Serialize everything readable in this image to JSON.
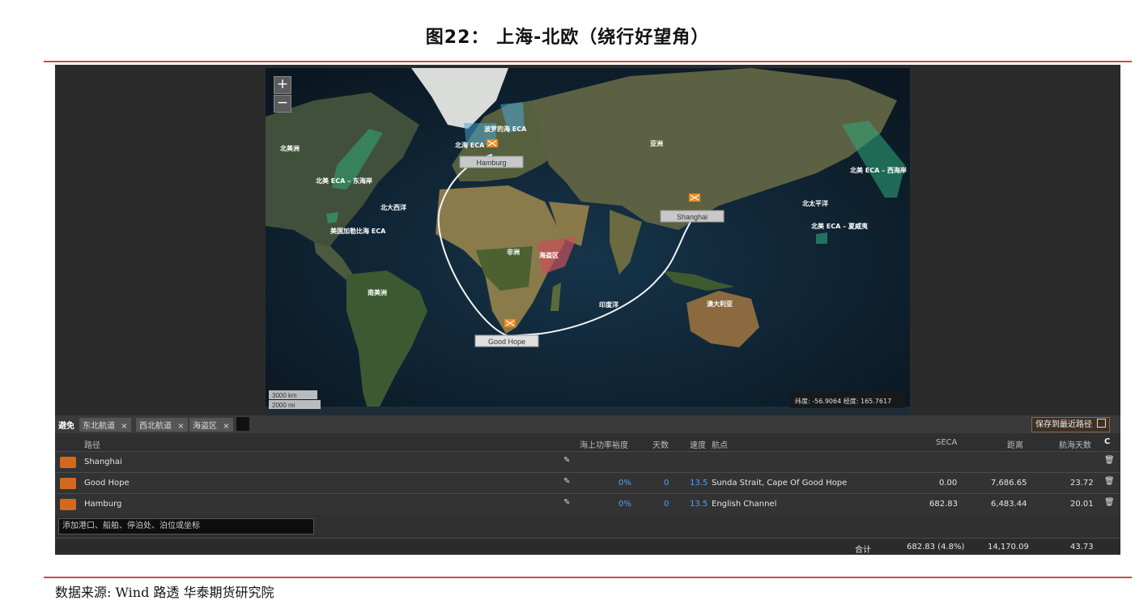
{
  "figure_title": "图22：  上海-北欧（绕行好望角）",
  "map": {
    "zoom_in": "+",
    "zoom_out": "−",
    "region_labels": {
      "north_america": "北美洲",
      "na_eca_east": "北美 ECA – 东海岸",
      "north_atlantic": "北大西洋",
      "us_caribbean_eca": "美国加勒比海 ECA",
      "south_america": "南美洲",
      "baltic_eca": "波罗的海 ECA",
      "north_sea_eca": "北海 ECA",
      "asia": "亚洲",
      "africa": "非洲",
      "piracy_zone": "海盗区",
      "indian_ocean": "印度洋",
      "north_pacific": "北太平洋",
      "na_eca_west": "北美 ECA – 西海岸",
      "na_eca_hawaii": "北美 ECA – 夏威夷",
      "australia": "澳大利亚"
    },
    "ports": {
      "hamburg": "Hamburg",
      "shanghai": "Shanghai",
      "good_hope": "Good Hope"
    },
    "scale_km": "3000 km",
    "scale_mi": "2000 mi",
    "coord_readout": "纬度: -56.9064 经度: 165.7617"
  },
  "toolbar": {
    "avoid_label": "避免",
    "tags": [
      "东北航道",
      "西北航道",
      "海盗区"
    ],
    "tag_close": "×",
    "save_button": "保存到最近路径",
    "save_icon": "save-icon"
  },
  "table": {
    "headers": {
      "route": "路径",
      "margin": "海上功率裕度",
      "days": "天数",
      "speed": "速度",
      "waypoints": "航点",
      "seca": "SECA",
      "distance": "距离",
      "sea_days": "航海天数",
      "refresh": "C"
    },
    "rows": [
      {
        "name": "Shanghai",
        "margin": "",
        "days": "",
        "speed": "",
        "waypoints": "",
        "seca": "",
        "distance": "",
        "sea_days": ""
      },
      {
        "name": "Good Hope",
        "margin": "0%",
        "days": "0",
        "speed": "13.5",
        "waypoints": "Sunda Strait, Cape Of Good Hope",
        "seca": "0.00",
        "distance": "7,686.65",
        "sea_days": "23.72"
      },
      {
        "name": "Hamburg",
        "margin": "0%",
        "days": "0",
        "speed": "13.5",
        "waypoints": "English Channel",
        "seca": "682.83",
        "distance": "6,483.44",
        "sea_days": "20.01"
      }
    ],
    "add_placeholder": "添加港口、船舶、停泊处、泊位或坐标",
    "total_label": "合计",
    "total_seca": "682.83 (4.8%)",
    "total_distance": "14,170.09",
    "total_sea_days": "43.73"
  },
  "source": "数据来源:  Wind 路透 华泰期货研究院"
}
